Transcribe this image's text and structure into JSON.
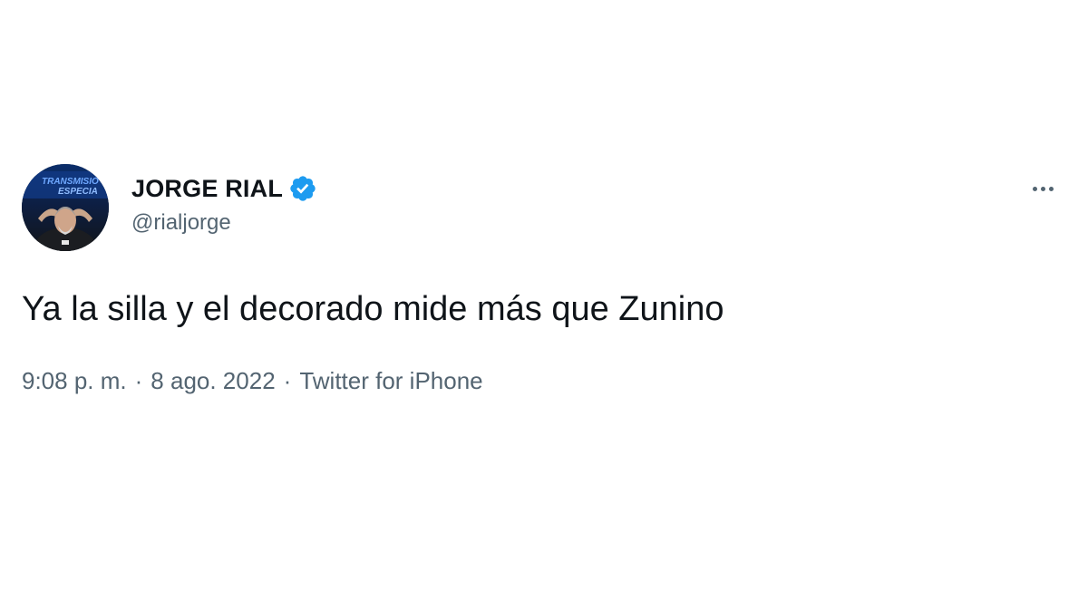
{
  "tweet": {
    "author": {
      "display_name": "JORGE RIAL",
      "handle": "@rialjorge",
      "verified": true,
      "avatar_banner_line1": "TRANSMISIÓ",
      "avatar_banner_line2": "ESPECIA"
    },
    "text": "Ya la silla y el decorado mide más que Zunino",
    "time": "9:08 p. m.",
    "separator": "·",
    "date": "8 ago. 2022",
    "source": "Twitter for iPhone",
    "more_icon": "more-horizontal-icon",
    "verified_icon": "verified-badge-icon"
  },
  "colors": {
    "text_primary": "#0f1419",
    "text_secondary": "#536471",
    "verified_blue": "#1d9bf0",
    "background": "#ffffff"
  }
}
